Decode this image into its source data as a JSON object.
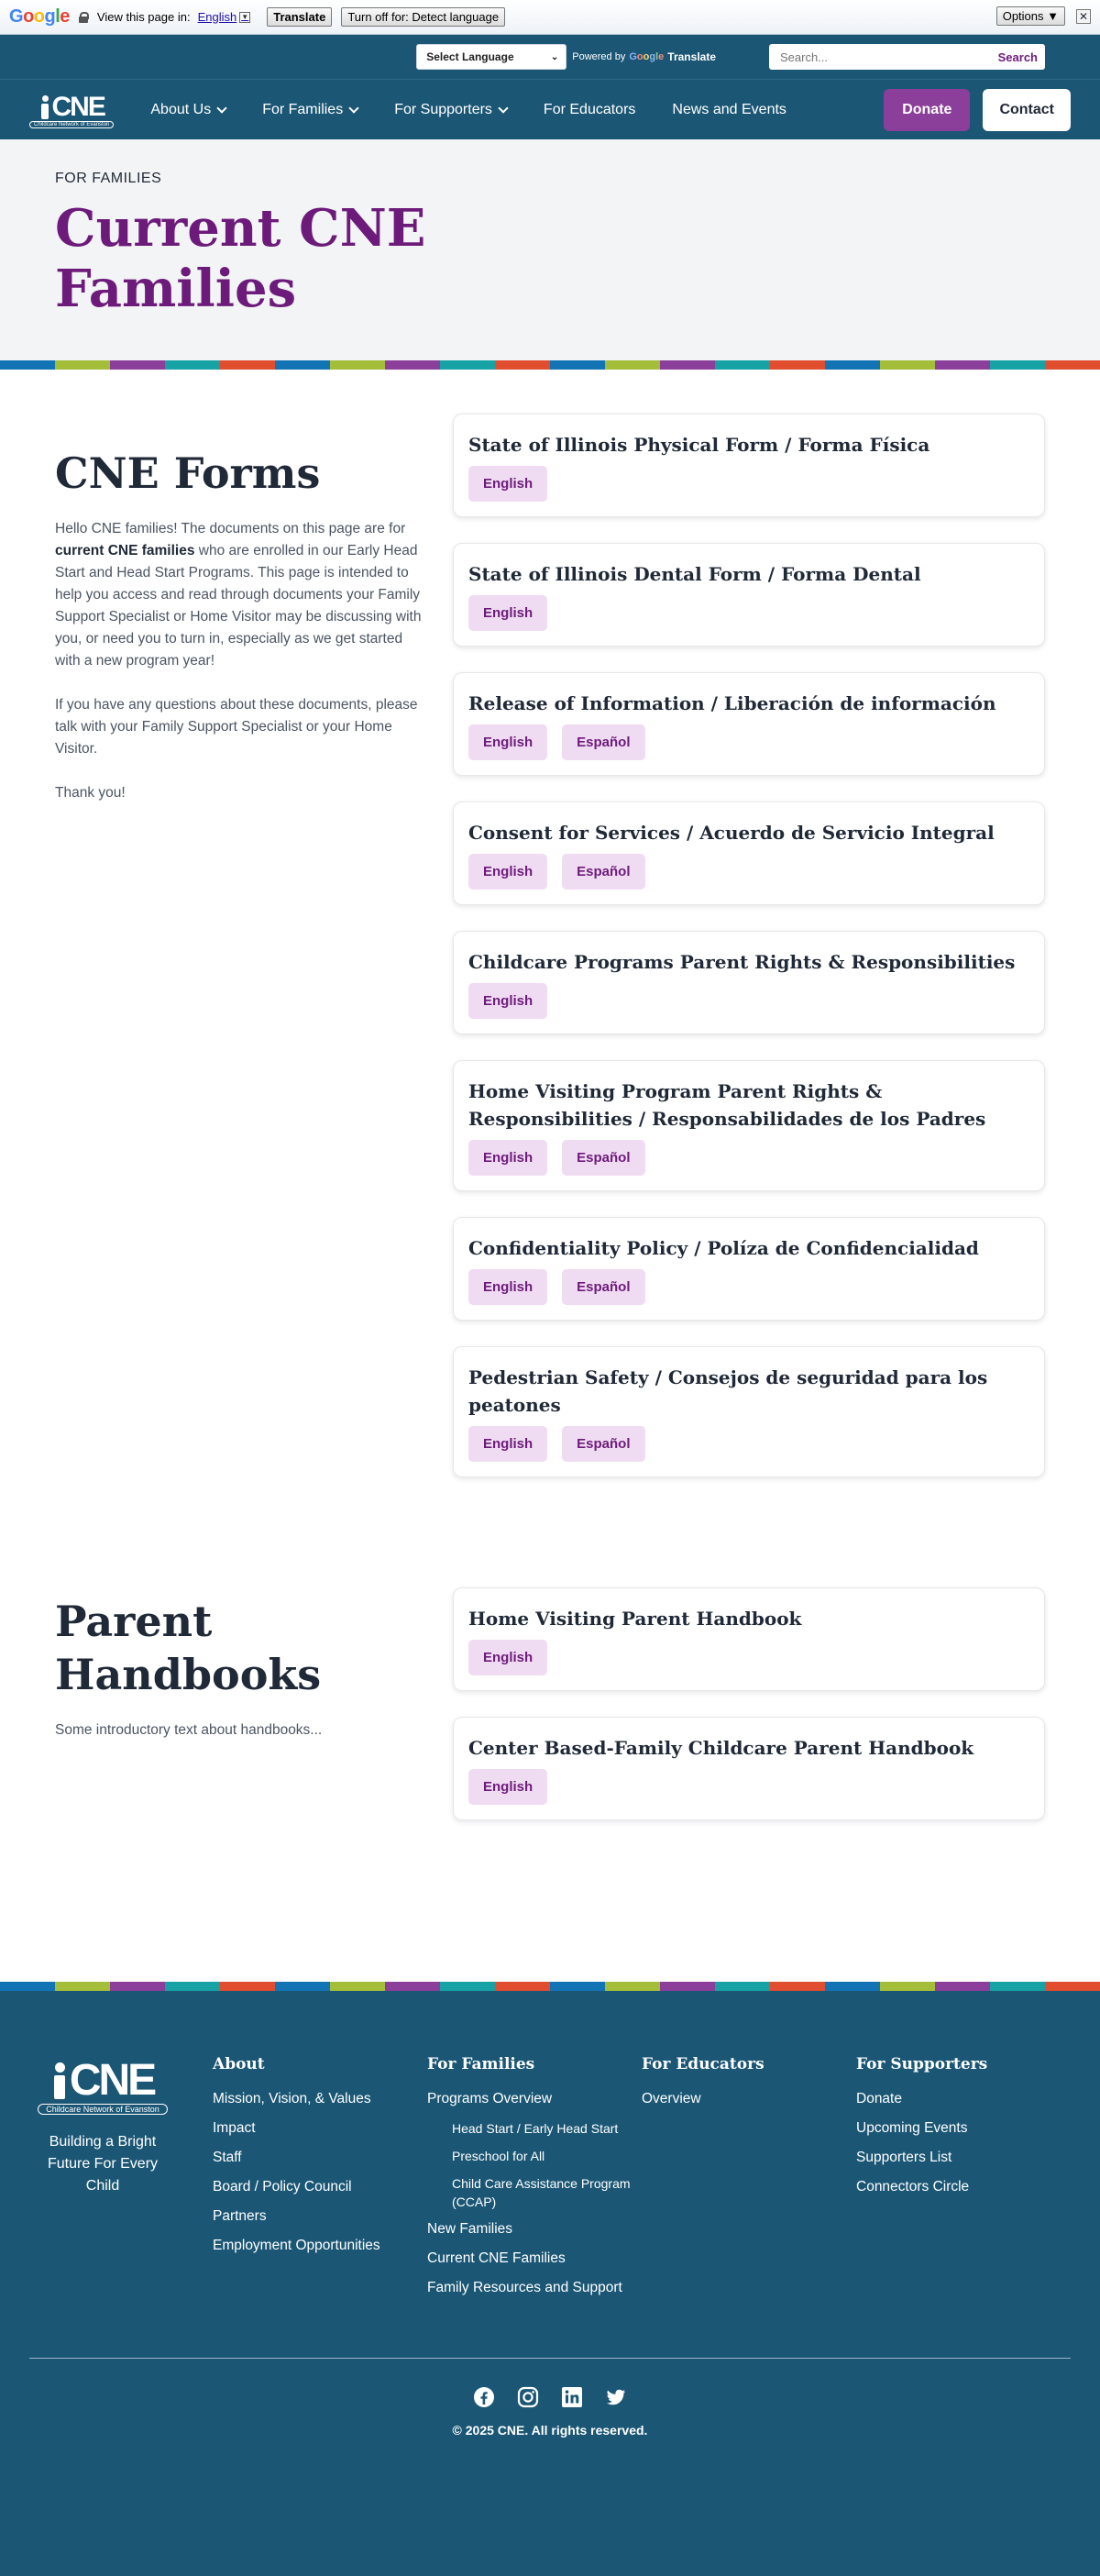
{
  "translate_bar": {
    "logo": "Google",
    "prompt": "View this page in:",
    "language": "English",
    "translate_button": "Translate",
    "turn_off_button": "Turn off for: Detect language",
    "options_button": "Options ▼",
    "close": "✕"
  },
  "utility": {
    "language_select": "Select Language",
    "powered_by": "Powered by",
    "google": "Google",
    "translate_word": "Translate",
    "search_placeholder": "Search...",
    "search_button": "Search"
  },
  "nav": {
    "logo": "CNE",
    "logo_sub": "Childcare Network of Evanston",
    "items": [
      "About Us",
      "For Families",
      "For Supporters",
      "For Educators",
      "News and Events"
    ],
    "donate": "Donate",
    "contact": "Contact"
  },
  "hero": {
    "eyebrow": "FOR FAMILIES",
    "title": "Current CNE Families"
  },
  "stripe_colors": [
    "#1273b5",
    "#a4be3a",
    "#8b3f9a",
    "#17a2a6",
    "#e04e2f"
  ],
  "forms": {
    "title": "CNE Forms",
    "intro_pre": "Hello CNE families! The documents on this page are for ",
    "intro_bold": "current CNE families",
    "intro_post": " who are enrolled in our Early Head Start and Head Start Programs. This page is intended to help you access and read through documents your Family Support Specialist or Home Visitor may be discussing with you, or need you to turn in, especially as we get started with a new program year!",
    "questions": "If you have any questions about these documents, please talk with your Family Support Specialist or your Home Visitor.",
    "thanks": "Thank you!",
    "cards": [
      {
        "title": "State of Illinois Physical Form / Forma Física",
        "buttons": [
          "English"
        ]
      },
      {
        "title": "State of Illinois Dental Form / Forma Dental",
        "buttons": [
          "English"
        ]
      },
      {
        "title": "Release of Information / Liberación de información",
        "buttons": [
          "English",
          "Español"
        ]
      },
      {
        "title": "Consent for Services / Acuerdo de Servicio Integral",
        "buttons": [
          "English",
          "Español"
        ]
      },
      {
        "title": "Childcare Programs Parent Rights & Responsibilities",
        "buttons": [
          "English"
        ]
      },
      {
        "title": "Home Visiting Program Parent Rights & Responsibilities / Responsabilidades de los Padres",
        "buttons": [
          "English",
          "Español"
        ]
      },
      {
        "title": "Confidentiality Policy / Políza de Confidencialidad",
        "buttons": [
          "English",
          "Español"
        ]
      },
      {
        "title": "Pedestrian Safety / Consejos de seguridad para los peatones",
        "buttons": [
          "English",
          "Español"
        ]
      }
    ]
  },
  "handbooks": {
    "title": "Parent Handbooks",
    "intro": "Some introductory text about handbooks...",
    "cards": [
      {
        "title": "Home Visiting Parent Handbook",
        "buttons": [
          "English"
        ]
      },
      {
        "title": "Center Based-Family Childcare Parent Handbook",
        "buttons": [
          "English"
        ]
      }
    ]
  },
  "footer": {
    "tagline": "Building a Bright Future For Every Child",
    "columns": [
      {
        "heading": "About",
        "links": [
          {
            "label": "Mission, Vision, & Values"
          },
          {
            "label": "Impact"
          },
          {
            "label": "Staff"
          },
          {
            "label": "Board / Policy Council"
          },
          {
            "label": "Partners"
          },
          {
            "label": "Employment Opportunities"
          }
        ]
      },
      {
        "heading": "For Families",
        "links": [
          {
            "label": "Programs Overview"
          },
          {
            "label": "Head Start / Early Head Start",
            "sub": true
          },
          {
            "label": "Preschool for All",
            "sub": true
          },
          {
            "label": "Child Care Assistance Program (CCAP)",
            "sub": true
          },
          {
            "label": "New Families"
          },
          {
            "label": "Current CNE Families"
          },
          {
            "label": "Family Resources and Support"
          }
        ]
      },
      {
        "heading": "For Educators",
        "links": [
          {
            "label": "Overview"
          }
        ]
      },
      {
        "heading": "For Supporters",
        "links": [
          {
            "label": "Donate"
          },
          {
            "label": "Upcoming Events"
          },
          {
            "label": "Supporters List"
          },
          {
            "label": "Connectors Circle"
          }
        ]
      }
    ],
    "socials": [
      "facebook-icon",
      "instagram-icon",
      "linkedin-icon",
      "twitter-icon"
    ],
    "copyright": "© 2025 CNE. All rights reserved."
  }
}
